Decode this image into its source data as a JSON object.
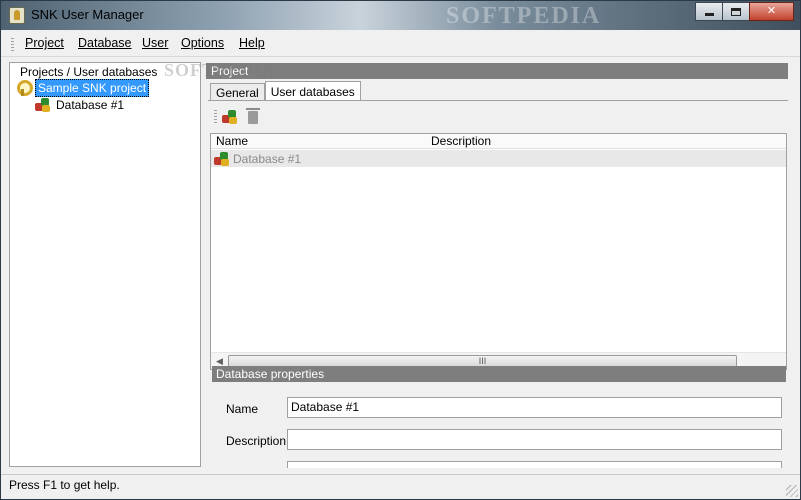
{
  "window": {
    "title": "SNK User Manager",
    "watermark": "SOFTPEDIA",
    "buttons": {
      "minimize": "minimize",
      "maximize": "maximize",
      "close": "✕"
    }
  },
  "menubar": {
    "items": [
      {
        "label": "Project"
      },
      {
        "label": "Database"
      },
      {
        "label": "User"
      },
      {
        "label": "Options"
      },
      {
        "label": "Help"
      }
    ]
  },
  "tree": {
    "header": "Projects / User databases",
    "project": {
      "label": "Sample SNK project",
      "icon": "key-icon"
    },
    "database": {
      "label": "Database #1",
      "icon": "database-puzzle-icon"
    }
  },
  "project_panel": {
    "header": "Project",
    "watermark": "SOFTPEDIA",
    "tabs": [
      {
        "label": "General"
      },
      {
        "label": "User databases"
      }
    ],
    "active_tab": "User databases",
    "toolbar": {
      "add_icon": "add-database-icon",
      "delete_icon": "trash-icon"
    },
    "list": {
      "columns": [
        "Name",
        "Description"
      ],
      "rows": [
        {
          "name": "Database #1",
          "description": ""
        }
      ],
      "scroll_thumb": "III"
    }
  },
  "database_properties": {
    "header": "Database properties",
    "name_label": "Name",
    "name_value": "Database #1",
    "description_label": "Description",
    "description_value": ""
  },
  "status": {
    "text": "Press F1 to get help."
  },
  "colors": {
    "selection": "#3399ff",
    "section_header": "#7e7e7e"
  }
}
